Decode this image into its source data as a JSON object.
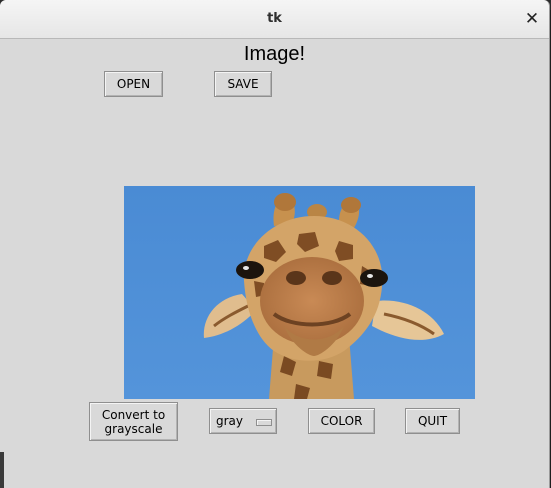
{
  "window": {
    "title": "tk",
    "close_symbol": "✕"
  },
  "main": {
    "heading": "Image!"
  },
  "toolbar": {
    "open_label": "OPEN",
    "save_label": "SAVE"
  },
  "image": {
    "subject": "giraffe photo"
  },
  "controls": {
    "convert_label": "Convert to\ngrayscale",
    "mode_selected": "gray",
    "color_label": "COLOR",
    "quit_label": "QUIT"
  },
  "colors": {
    "window_bg": "#d9d9d9",
    "sky": "#4f8fd6"
  }
}
